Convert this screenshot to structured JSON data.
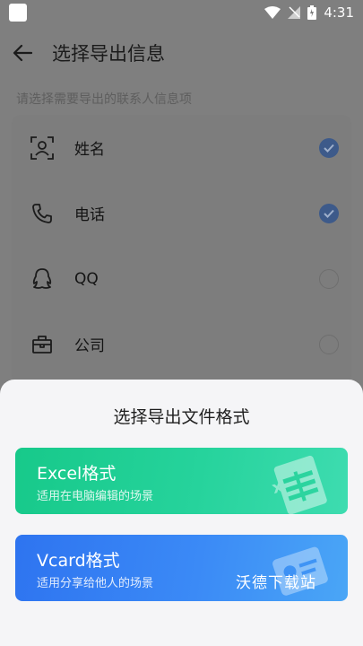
{
  "status_bar": {
    "time": "4:31"
  },
  "header": {
    "title": "选择导出信息"
  },
  "hint": "请选择需要导出的联系人信息项",
  "fields": [
    {
      "label": "姓名",
      "icon": "person-icon",
      "checked": true
    },
    {
      "label": "电话",
      "icon": "phone-icon",
      "checked": true
    },
    {
      "label": "QQ",
      "icon": "qq-icon",
      "checked": false
    },
    {
      "label": "公司",
      "icon": "briefcase-icon",
      "checked": false
    }
  ],
  "sheet": {
    "title": "选择导出文件格式",
    "options": [
      {
        "title": "Excel格式",
        "desc": "适用在电脑编辑的场景"
      },
      {
        "title": "Vcard格式",
        "desc": "适用分享给他人的场景"
      }
    ],
    "watermark": "沃德下载站"
  },
  "colors": {
    "excel": "#1fcf93",
    "vcard": "#3583f4",
    "checked": "#3d5a8a"
  }
}
